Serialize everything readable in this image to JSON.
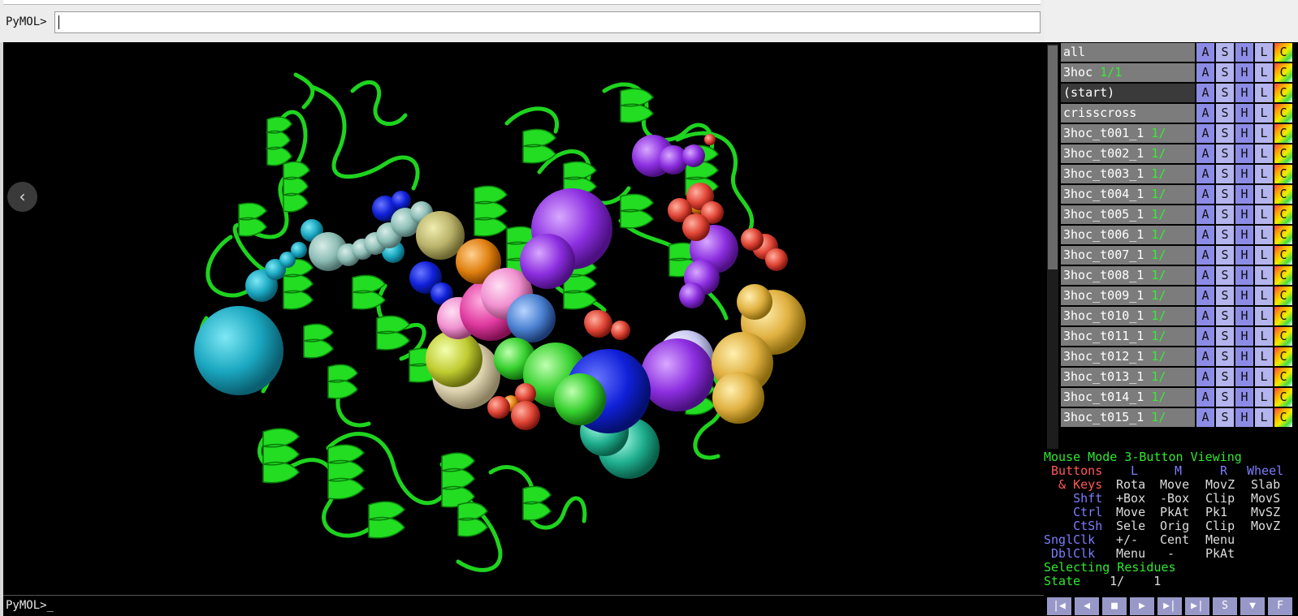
{
  "command": {
    "prompt": "PyMOL>",
    "value": ""
  },
  "bottom_prompt": "PyMOL>_",
  "nav": {
    "back_icon": "‹"
  },
  "objects": [
    {
      "name": "all",
      "count": ""
    },
    {
      "name": "3hoc",
      "count": " 1/1"
    },
    {
      "name": "(start)",
      "count": "",
      "dark": true
    },
    {
      "name": "crisscross",
      "count": ""
    },
    {
      "name": "3hoc_t001_1",
      "count": " 1/"
    },
    {
      "name": "3hoc_t002_1",
      "count": " 1/"
    },
    {
      "name": "3hoc_t003_1",
      "count": " 1/"
    },
    {
      "name": "3hoc_t004_1",
      "count": " 1/"
    },
    {
      "name": "3hoc_t005_1",
      "count": " 1/"
    },
    {
      "name": "3hoc_t006_1",
      "count": " 1/"
    },
    {
      "name": "3hoc_t007_1",
      "count": " 1/"
    },
    {
      "name": "3hoc_t008_1",
      "count": " 1/"
    },
    {
      "name": "3hoc_t009_1",
      "count": " 1/"
    },
    {
      "name": "3hoc_t010_1",
      "count": " 1/"
    },
    {
      "name": "3hoc_t011_1",
      "count": " 1/"
    },
    {
      "name": "3hoc_t012_1",
      "count": " 1/"
    },
    {
      "name": "3hoc_t013_1",
      "count": " 1/"
    },
    {
      "name": "3hoc_t014_1",
      "count": " 1/"
    },
    {
      "name": "3hoc_t015_1",
      "count": " 1/"
    }
  ],
  "object_buttons": [
    "A",
    "S",
    "H",
    "L",
    "C"
  ],
  "mouse": {
    "title": "Mouse Mode 3-Button Viewing",
    "buttons": {
      "label": " Buttons",
      "l": "L",
      "m": "M",
      "r": "R",
      "wheel": "Wheel"
    },
    "keys": {
      "label": "  & Keys",
      "rota": "Rota",
      "move": "Move",
      "movz": "MovZ",
      "slab": "Slab"
    },
    "shft": {
      "label": "    Shft",
      "a": "+Box",
      "b": "-Box",
      "c": "Clip",
      "d": "MovS"
    },
    "ctrl": {
      "label": "    Ctrl",
      "a": "Move",
      "b": "PkAt",
      "c": "Pk1 ",
      "d": "MvSZ"
    },
    "ctsh": {
      "label": "    CtSh",
      "a": "Sele",
      "b": "Orig",
      "c": "Clip",
      "d": "MovZ"
    },
    "sngl": {
      "label": "SnglClk",
      "a": "+/- ",
      "b": "Cent",
      "c": "Menu"
    },
    "dbl": {
      "label": " DblClk",
      "a": "Menu",
      "b": " -  ",
      "c": "PkAt"
    },
    "selecting": "Selecting Residues",
    "state_label": "State",
    "state_value": "    1/    1"
  },
  "playback": [
    "|◀",
    "◀",
    "■",
    "▶",
    "▶|",
    "▶|",
    "S",
    "▼",
    "F"
  ],
  "colors": {
    "cartoon": "#22dd22",
    "background": "#000000",
    "panel_gray": "#7c7c7c"
  }
}
